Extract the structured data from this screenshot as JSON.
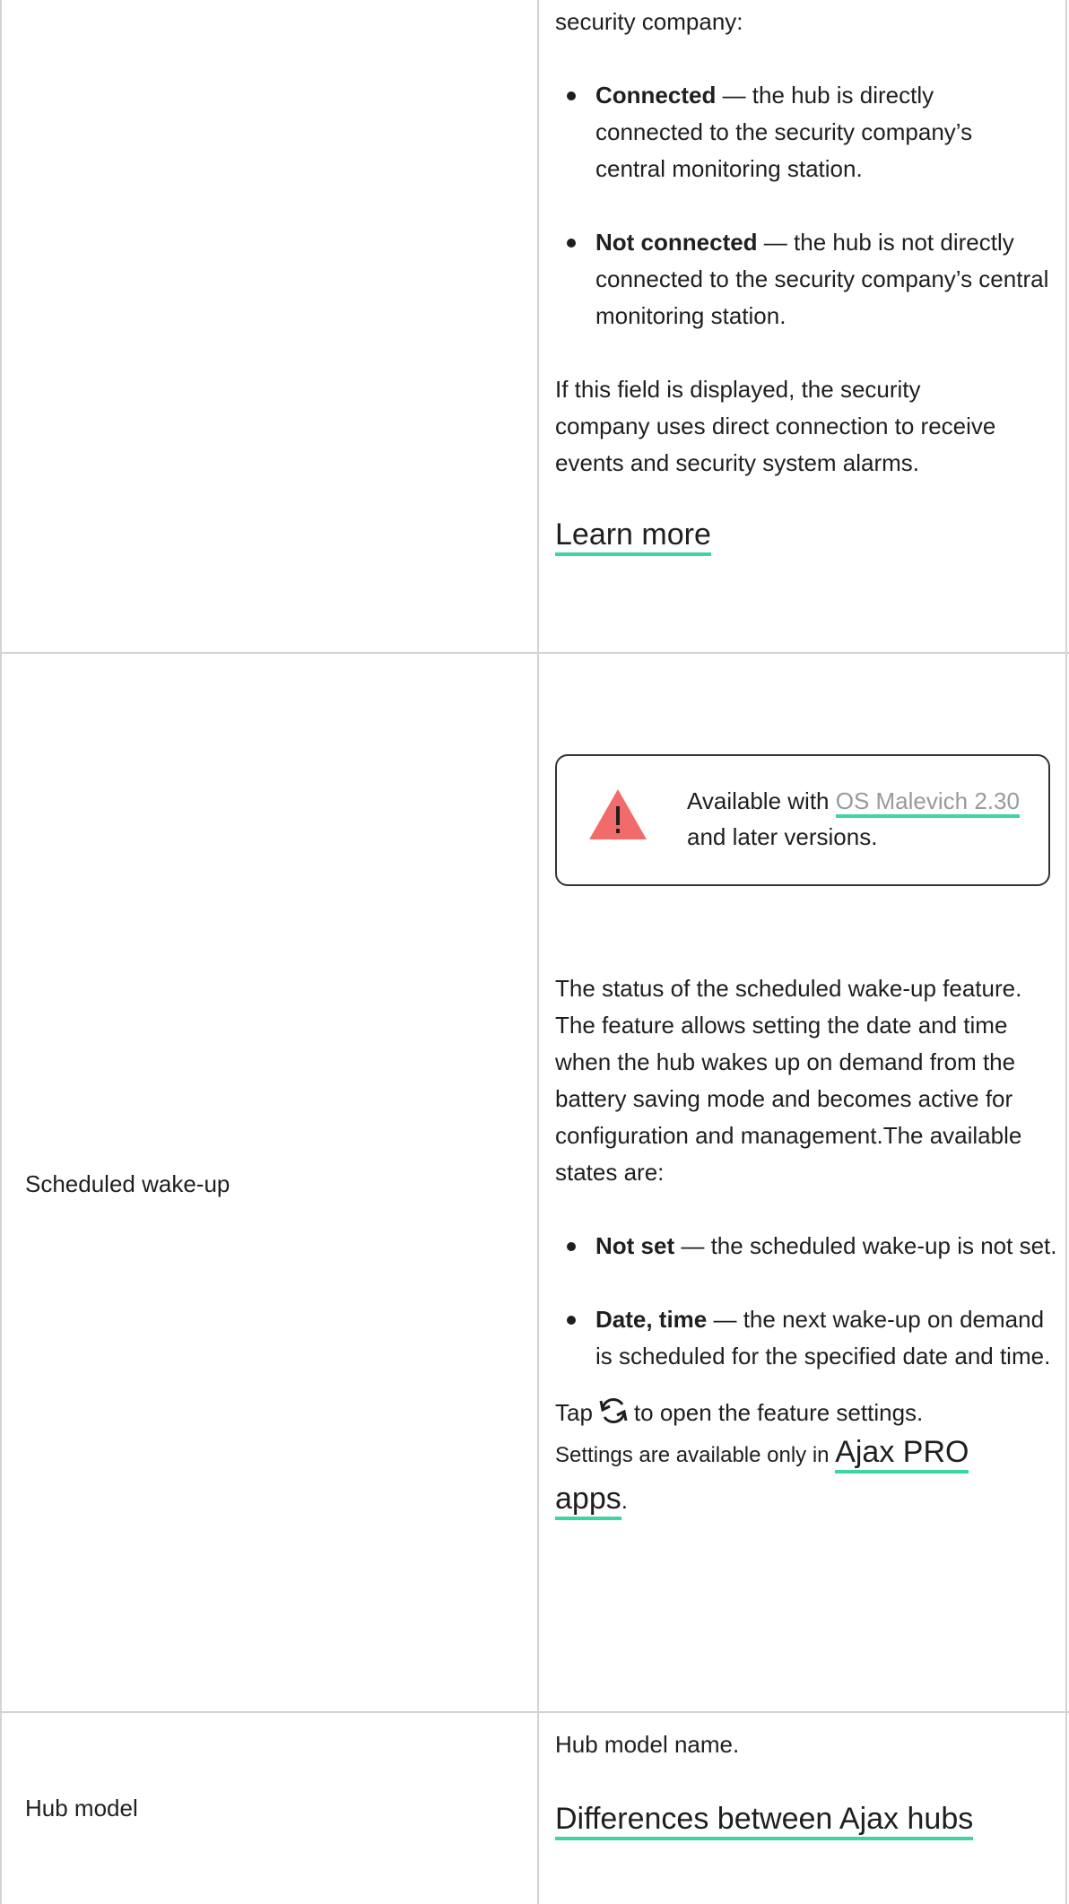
{
  "row1": {
    "intro": "security company:",
    "bullets": [
      {
        "term": "Connected",
        "text": " — the hub is directly connected to the security company’s central monitoring station."
      },
      {
        "term": "Not connected",
        "text": " — the hub is not directly connected to the security company’s central monitoring station."
      }
    ],
    "note": "If this field is displayed, the security company uses direct connection to receive events and security system alarms.",
    "link": "Learn more"
  },
  "row2": {
    "label": "Scheduled wake-up",
    "notice": {
      "icon": "warning-triangle-icon",
      "prefix": "Available with ",
      "link": "OS Malevich 2.30",
      "suffix": " and later versions."
    },
    "description": "The status of the scheduled wake-up feature. The feature allows setting the date and time when the hub wakes up on demand from the battery saving mode and becomes active for configuration and management.The available states are:",
    "bullets": [
      {
        "term": "Not set",
        "text": " — the scheduled wake-up is not set."
      },
      {
        "term": "Date, time",
        "text": " — the next wake-up on demand is scheduled for the specified date and time."
      }
    ],
    "tap_prefix": "Tap",
    "tap_icon": "sync-icon",
    "tap_suffix": "to open the feature settings.",
    "settings_text": "Settings are available only in ",
    "settings_link": "Ajax PRO apps",
    "settings_end": "."
  },
  "row3": {
    "label": "Hub model",
    "description": "Hub model name.",
    "link": "Differences between Ajax hubs"
  },
  "colors": {
    "accent": "#3ed5a1",
    "warning": "#f26b6b",
    "border": "#d3d3d3"
  }
}
